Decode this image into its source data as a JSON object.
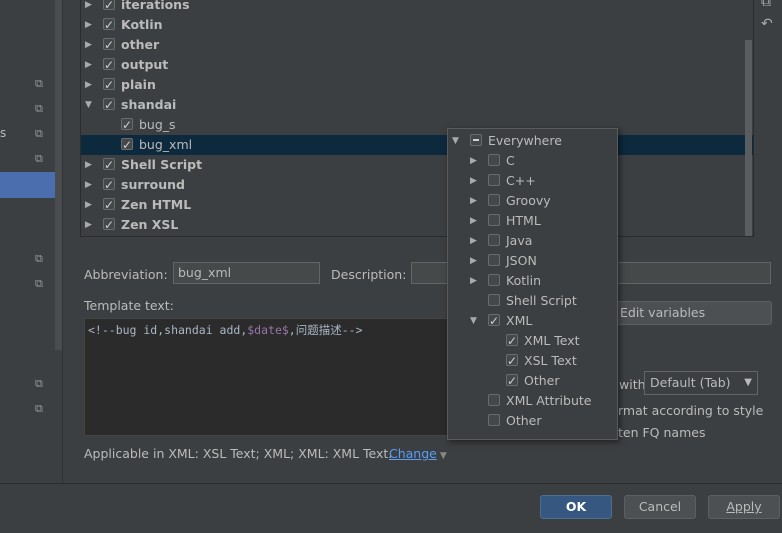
{
  "tree": {
    "groups": [
      {
        "label": "iterations",
        "checked": true,
        "expanded": false
      },
      {
        "label": "Kotlin",
        "checked": true,
        "expanded": false
      },
      {
        "label": "other",
        "checked": true,
        "expanded": false
      },
      {
        "label": "output",
        "checked": true,
        "expanded": false
      },
      {
        "label": "plain",
        "checked": true,
        "expanded": false
      },
      {
        "label": "shandai",
        "checked": true,
        "expanded": true
      },
      {
        "label": "bug_s",
        "checked": true,
        "child": true
      },
      {
        "label": "bug_xml",
        "checked": true,
        "child": true,
        "selected": true
      },
      {
        "label": "Shell Script",
        "checked": true,
        "expanded": false
      },
      {
        "label": "surround",
        "checked": true,
        "expanded": false
      },
      {
        "label": "Zen HTML",
        "checked": true,
        "expanded": false
      },
      {
        "label": "Zen XSL",
        "checked": true,
        "expanded": false
      }
    ]
  },
  "form": {
    "abbreviation_label": "Abbreviation:",
    "abbreviation_value": "bug_xml",
    "description_label": "Description:",
    "description_value": "",
    "template_label": "Template text:",
    "template_prefix": "<!--bug id,shandai add,",
    "template_var": "$date$",
    "template_suffix": ",问题描述-->",
    "edit_variables": "Edit variables",
    "expand_with_label": "with",
    "expand_with_value": "Default (Tab)",
    "reformat_label": "rmat according to style",
    "shorten_label": "ten FQ names",
    "applicable_text": "Applicable in XML: XSL Text; XML; XML: XML Text.",
    "change_link": "Change"
  },
  "popup": {
    "items": [
      {
        "label": "Everywhere",
        "state": "partial",
        "arrow": "down",
        "level": 0
      },
      {
        "label": "C",
        "state": "off",
        "arrow": "right",
        "level": 1
      },
      {
        "label": "C++",
        "state": "off",
        "arrow": "right",
        "level": 1
      },
      {
        "label": "Groovy",
        "state": "off",
        "arrow": "right",
        "level": 1
      },
      {
        "label": "HTML",
        "state": "off",
        "arrow": "right",
        "level": 1
      },
      {
        "label": "Java",
        "state": "off",
        "arrow": "right",
        "level": 1
      },
      {
        "label": "JSON",
        "state": "off",
        "arrow": "right",
        "level": 1
      },
      {
        "label": "Kotlin",
        "state": "off",
        "arrow": "right",
        "level": 1
      },
      {
        "label": "Shell Script",
        "state": "off",
        "arrow": "none",
        "level": 1
      },
      {
        "label": "XML",
        "state": "on",
        "arrow": "down",
        "level": 1
      },
      {
        "label": "XML Text",
        "state": "on",
        "arrow": "none",
        "level": 2
      },
      {
        "label": "XSL Text",
        "state": "on",
        "arrow": "none",
        "level": 2
      },
      {
        "label": "Other",
        "state": "on",
        "arrow": "none",
        "level": 2
      },
      {
        "label": "XML Attribute",
        "state": "off",
        "arrow": "none",
        "level": 1
      },
      {
        "label": "Other",
        "state": "off",
        "arrow": "none",
        "level": 1
      }
    ]
  },
  "buttons": {
    "ok": "OK",
    "cancel": "Cancel",
    "apply": "Apply"
  },
  "left_panel": {
    "letter": "s"
  },
  "colors": {
    "selection": "#4b6eaf",
    "tree_selection": "#0d293e",
    "link": "#589df6",
    "primary_button": "#365880"
  }
}
